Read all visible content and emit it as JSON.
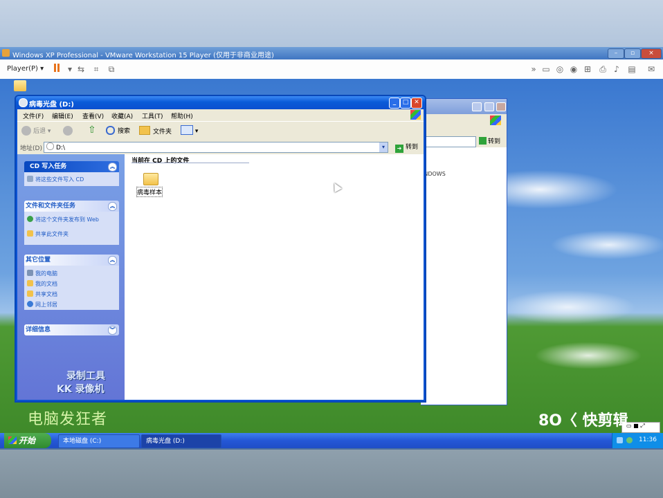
{
  "vm": {
    "title": "Windows XP Professional - VMware Workstation 15 Player (仅用于非商业用途)",
    "menu_label": "Player(P) ▾"
  },
  "explorer_main": {
    "title": "病毒光盘 (D:)",
    "menus": [
      "文件(F)",
      "编辑(E)",
      "查看(V)",
      "收藏(A)",
      "工具(T)",
      "帮助(H)"
    ],
    "toolbar": {
      "back": "后退",
      "search": "搜索",
      "folders": "文件夹"
    },
    "address_label": "地址(D)",
    "address_value": "D:\\",
    "go_label": "转到",
    "content_header": "当前在 CD 上的文件",
    "items": [
      {
        "name": "病毒样本"
      }
    ],
    "task_pane": {
      "cd_tasks": {
        "title": "CD 写入任务",
        "links": [
          "将这些文件写入 CD"
        ]
      },
      "file_tasks": {
        "title": "文件和文件夹任务",
        "links": [
          "将这个文件夹发布到 Web",
          "共享此文件夹"
        ]
      },
      "other_places": {
        "title": "其它位置",
        "links": [
          "我的电脑",
          "我的文档",
          "共享文档",
          "网上邻居"
        ]
      },
      "details": {
        "title": "详细信息"
      }
    }
  },
  "explorer_back": {
    "go_label": "转到",
    "partial_text": "INDOWS"
  },
  "taskbar": {
    "start_label": "开始",
    "tasks": [
      {
        "label": "本地磁盘 (C:)"
      },
      {
        "label": "病毒光盘 (D:)"
      }
    ],
    "clock": "11:36"
  },
  "overlays": {
    "recorder_lines": [
      "录制工具",
      "KK 录像机"
    ],
    "channel_watermark": "电脑发狂者",
    "app_watermark": "8O〈 快剪辑"
  }
}
